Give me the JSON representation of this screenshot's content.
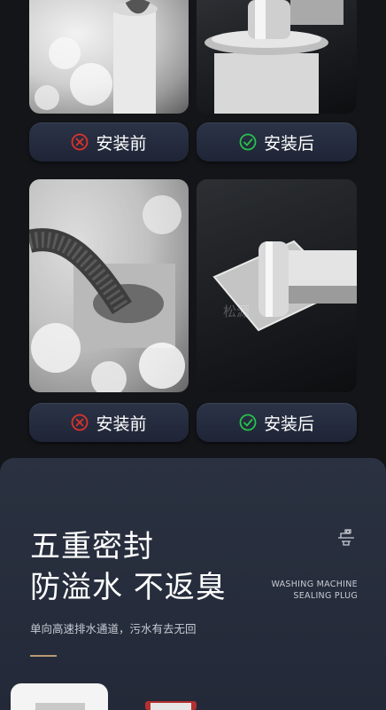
{
  "comparison": [
    {
      "before_label": "安装前",
      "after_label": "安装后"
    },
    {
      "before_label": "安装前",
      "after_label": "安装后"
    }
  ],
  "watermark": "松源",
  "promo": {
    "headline_1": "五重密封",
    "headline_2": "防溢水 不返臭",
    "english_1": "WASHING MACHINE",
    "english_2": "SEALING PLUG",
    "subtitle": "单向高速排水通道，污水有去无回",
    "icon": "drain-plug-icon"
  },
  "colors": {
    "before_x": "#e0312b",
    "after_check": "#27c24c",
    "accent_rule": "#b89a74"
  }
}
